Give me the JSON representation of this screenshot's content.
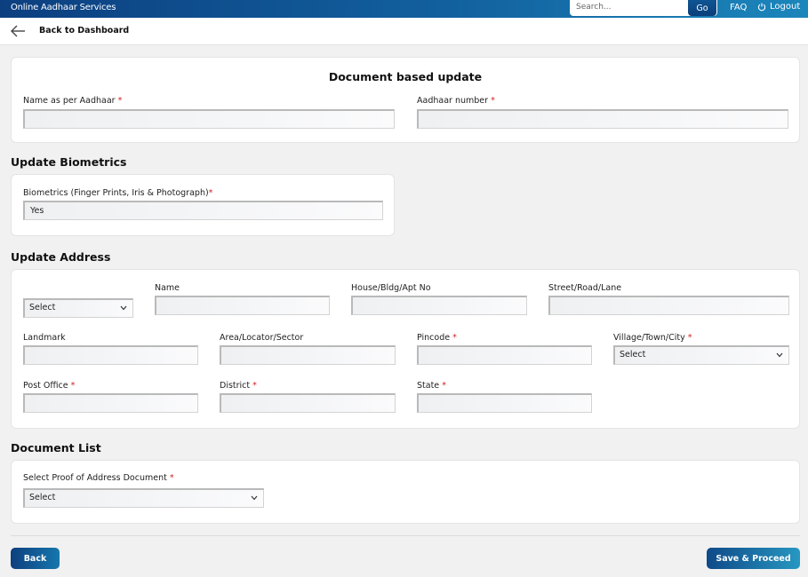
{
  "header": {
    "brand": "Online Aadhaar Services",
    "search_placeholder": "Search...",
    "go_label": "Go",
    "faq_label": "FAQ",
    "logout_label": "Logout"
  },
  "nav": {
    "back_to_dashboard": "Back to Dashboard"
  },
  "document_update": {
    "title": "Document based update",
    "name_label": "Name as per Aadhaar",
    "name_value": "",
    "aadhaar_label": "Aadhaar number",
    "aadhaar_value": "",
    "required_mark": "*"
  },
  "biometrics": {
    "section_title": "Update Biometrics",
    "label": "Biometrics (Finger Prints, Iris & Photograph)",
    "value": "Yes"
  },
  "address": {
    "section_title": "Update Address",
    "care_of_select": "Select",
    "name_label": "Name",
    "house_label": "House/Bldg/Apt No",
    "street_label": "Street/Road/Lane",
    "landmark_label": "Landmark",
    "area_label": "Area/Locator/Sector",
    "pincode_label": "Pincode",
    "village_label": "Village/Town/City",
    "village_select": "Select",
    "post_office_label": "Post Office",
    "district_label": "District",
    "state_label": "State"
  },
  "documents": {
    "section_title": "Document List",
    "proof_label": "Select Proof of Address Document",
    "proof_select": "Select"
  },
  "footer": {
    "back_label": "Back",
    "save_label": "Save & Proceed"
  },
  "colors": {
    "header_dark": "#0c3f80",
    "header_light": "#1b86bb",
    "required": "#d02020"
  }
}
